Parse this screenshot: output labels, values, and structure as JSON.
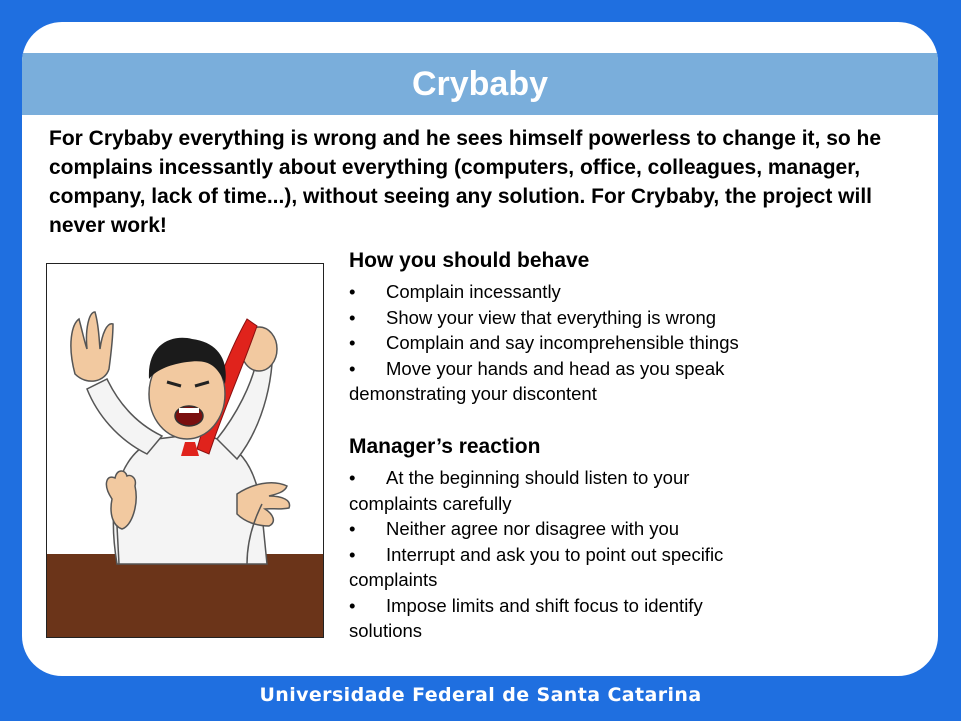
{
  "slide": {
    "title": "Crybaby",
    "intro": "For Crybaby everything is wrong and he sees himself powerless to change it, so he complains incessantly about everything (computers, office, colleagues, manager, company, lack of time...), without seeing any solution. For Crybaby, the project will never work!"
  },
  "behave": {
    "heading": "How you should behave",
    "items": [
      "Complain incessantly",
      "Show your view that everything is wrong",
      "Complain and say incomprehensible things",
      "Move your hands and head as you speak demonstrating your discontent"
    ]
  },
  "reaction": {
    "heading": "Manager’s reaction",
    "items": [
      "At the beginning should listen to your complaints carefully",
      "Neither agree nor disagree with you",
      "Interrupt and ask you to point out specific complaints",
      "Impose limits and shift focus to identify solutions"
    ]
  },
  "footer": {
    "text": "Universidade Federal de Santa Catarina"
  },
  "bullet_char": "•",
  "colors": {
    "background": "#1f6fe0",
    "title_bar": "#7aaedb",
    "desk": "#6b3419",
    "tie": "#e0231c"
  }
}
